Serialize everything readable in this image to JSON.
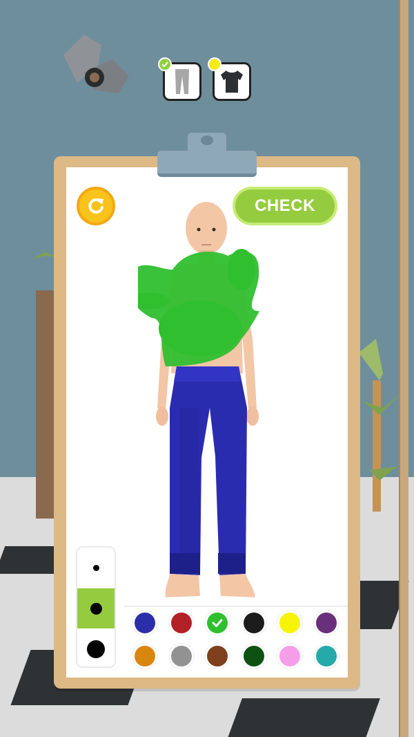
{
  "game": {
    "check_label": "CHECK",
    "reset_icon": "refresh-icon"
  },
  "outfit_progress": [
    {
      "item": "pants",
      "icon": "pants-icon",
      "status": "done",
      "badge_color": "#8fd13f"
    },
    {
      "item": "shirt",
      "icon": "tshirt-icon",
      "status": "current",
      "badge_color": "#f7ea1b"
    }
  ],
  "brush_sizes": [
    {
      "size": "small",
      "selected": false
    },
    {
      "size": "medium",
      "selected": true
    },
    {
      "size": "large",
      "selected": false
    }
  ],
  "palette": [
    {
      "name": "blue",
      "color": "#2b2ea8",
      "selected": false
    },
    {
      "name": "red",
      "color": "#b32025",
      "selected": false
    },
    {
      "name": "green",
      "color": "#2fbf2f",
      "selected": true
    },
    {
      "name": "black",
      "color": "#1c1c1c",
      "selected": false
    },
    {
      "name": "yellow",
      "color": "#f7f408",
      "selected": false
    },
    {
      "name": "purple",
      "color": "#6a2f7a",
      "selected": false
    },
    {
      "name": "orange",
      "color": "#d9860f",
      "selected": false
    },
    {
      "name": "gray",
      "color": "#929292",
      "selected": false
    },
    {
      "name": "brown",
      "color": "#7d3f1d",
      "selected": false
    },
    {
      "name": "dark-green",
      "color": "#0d5212",
      "selected": false
    },
    {
      "name": "pink",
      "color": "#f59ee8",
      "selected": false
    },
    {
      "name": "teal",
      "color": "#25a9a9",
      "selected": false
    }
  ],
  "colors": {
    "accent_green": "#95cc3f",
    "paint_green": "#2fbf2f",
    "pants_blue": "#2a2cb0",
    "skin": "#f3c6a6"
  }
}
